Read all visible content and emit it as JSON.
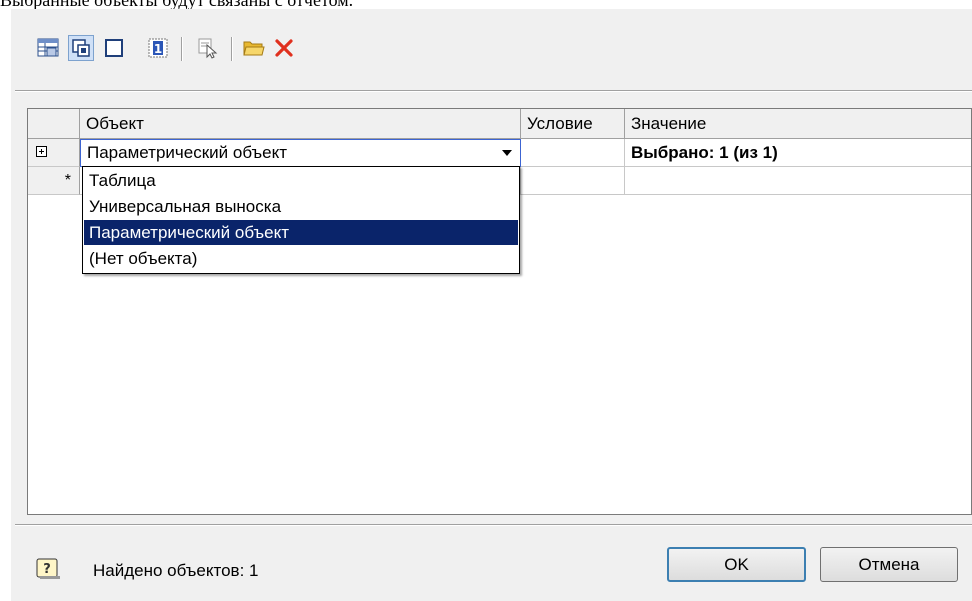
{
  "header": {
    "text": "Выбранные объекты будут связаны с отчетом."
  },
  "toolbar": {
    "icons": [
      "table-icon",
      "parametric-object-icon",
      "rectangle-icon",
      "number-one-icon",
      "select-object-icon",
      "open-folder-icon",
      "delete-icon"
    ]
  },
  "grid": {
    "columns": {
      "object": "Объект",
      "condition": "Условие",
      "value": "Значение"
    },
    "row": {
      "object": "Параметрический объект",
      "condition": "",
      "value": "Выбрано: 1 (из 1)"
    },
    "new_row_marker": "*"
  },
  "dropdown": {
    "options": [
      "Таблица",
      "Универсальная выноска",
      "Параметрический объект",
      "(Нет объекта)"
    ],
    "selected_index": 2
  },
  "status": {
    "text": "Найдено объектов: 1",
    "icon": "help-icon"
  },
  "buttons": {
    "ok": "OK",
    "cancel": "Отмена"
  },
  "colors": {
    "selection": "#0a246a",
    "focus_border": "#3c64d2",
    "delete": "#e0301e",
    "folder": "#e8b830"
  }
}
